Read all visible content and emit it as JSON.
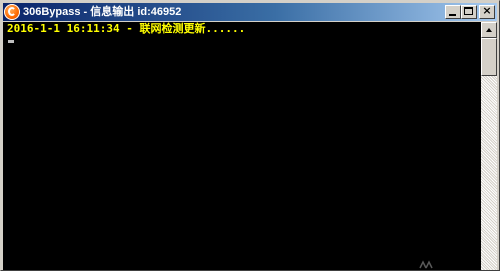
{
  "window": {
    "title": "306Bypass - 信息输出 id:46952",
    "icon": "app-icon",
    "controls": {
      "minimize_icon": "minimize-icon",
      "maximize_icon": "maximize-icon",
      "close_icon": "close-icon",
      "close_glyph": "×"
    }
  },
  "console": {
    "lines": [
      "2016-1-1 16:11:34 - 联网检测更新......"
    ],
    "text_color": "#ffff00",
    "background": "#000000"
  },
  "scrollbar": {
    "up_icon": "scroll-up-icon"
  },
  "colors": {
    "titlebar_start": "#0a246a",
    "titlebar_end": "#a6caf0",
    "chrome": "#d4d0c8"
  }
}
